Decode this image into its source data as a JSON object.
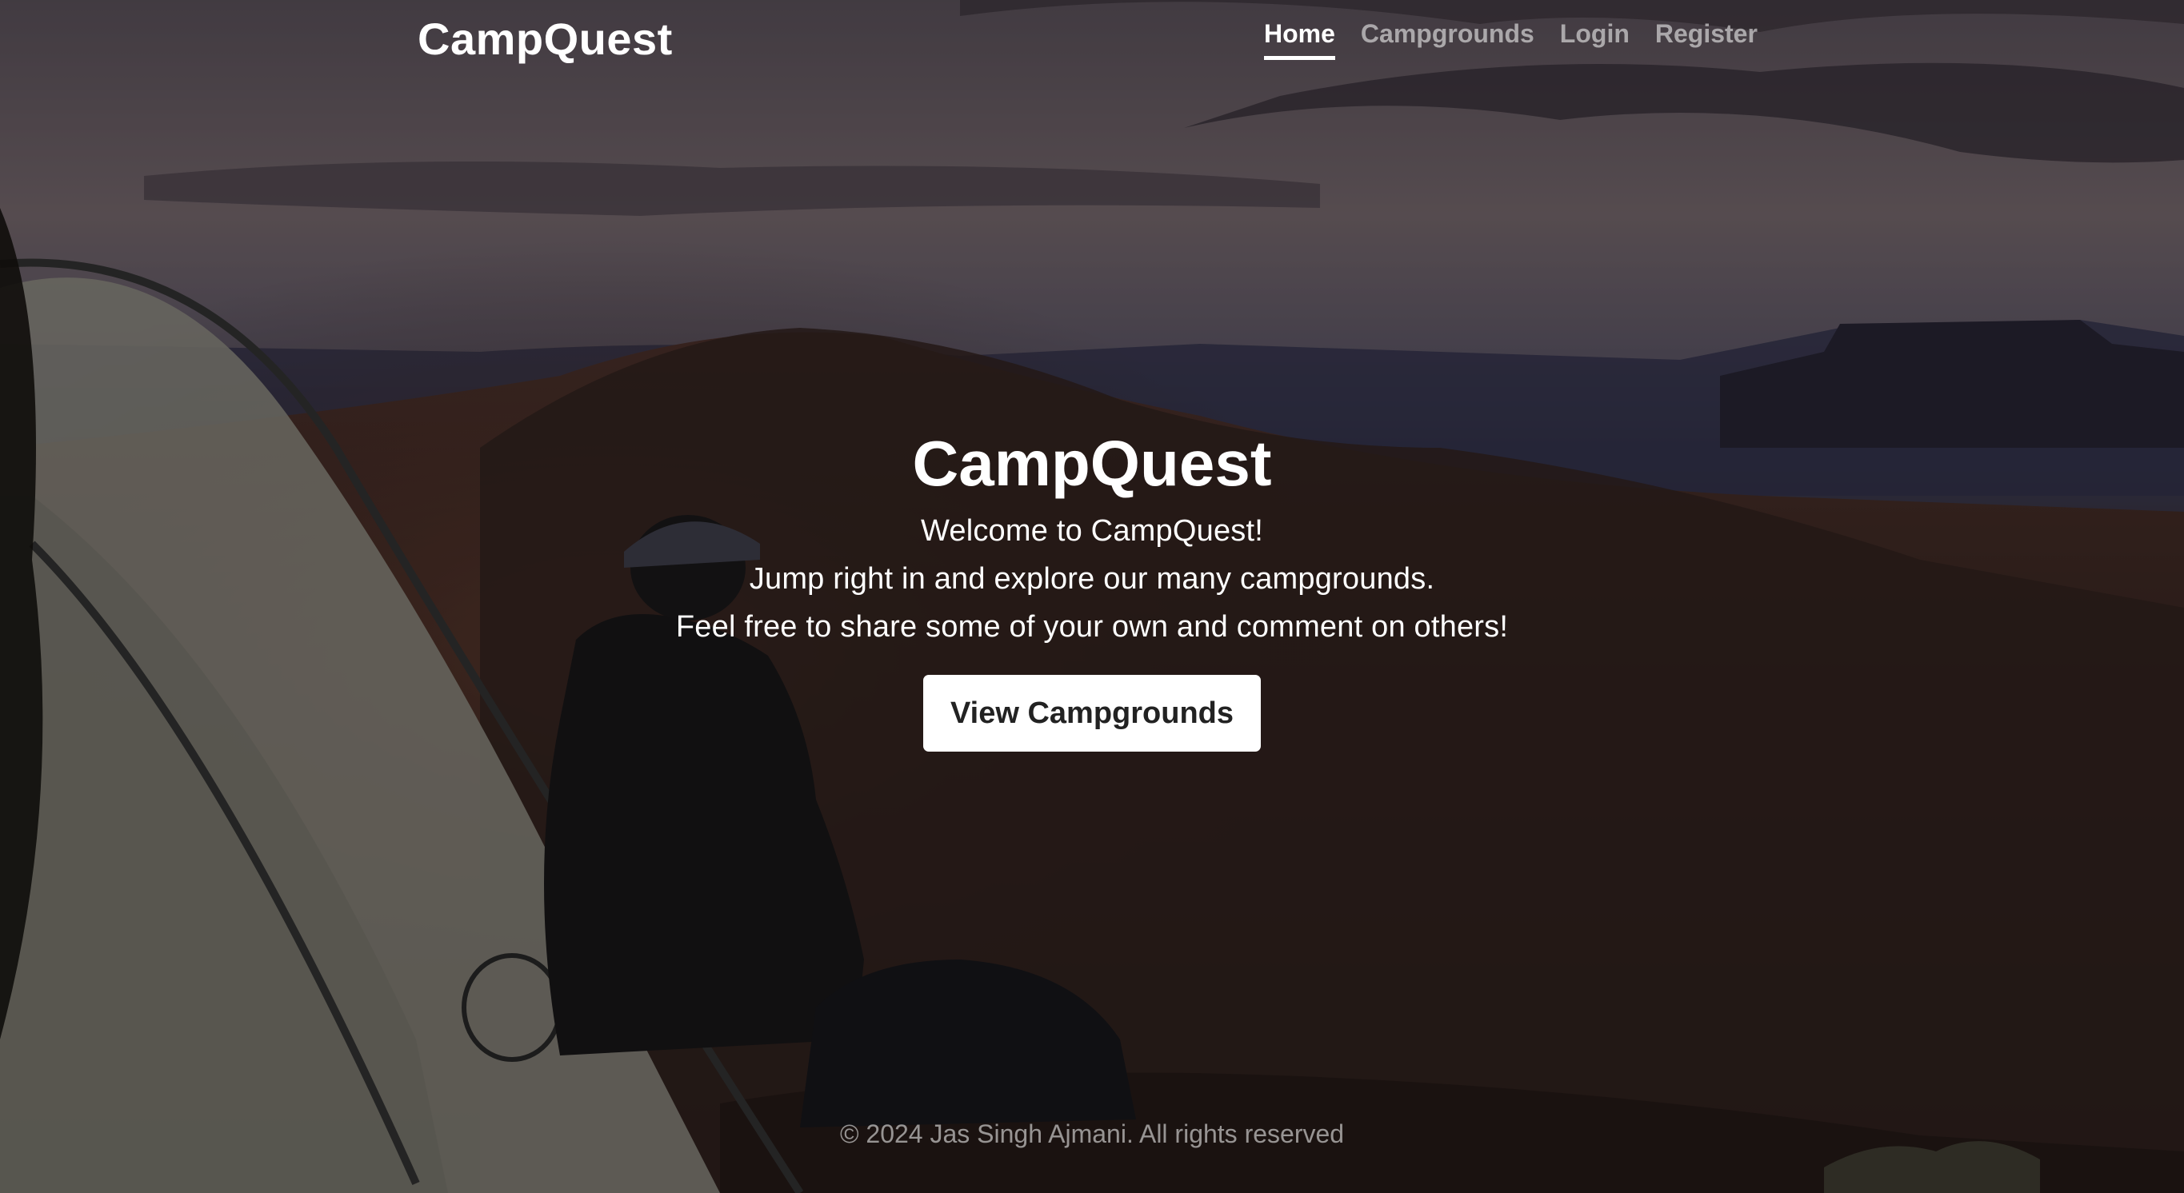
{
  "brand": {
    "name": "CampQuest"
  },
  "nav": {
    "items": [
      {
        "label": "Home",
        "active": true
      },
      {
        "label": "Campgrounds",
        "active": false
      },
      {
        "label": "Login",
        "active": false
      },
      {
        "label": "Register",
        "active": false
      }
    ]
  },
  "hero": {
    "title": "CampQuest",
    "lines": [
      "Welcome to CampQuest!",
      "Jump right in and explore our many campgrounds.",
      "Feel free to share some of your own and comment on others!"
    ],
    "cta_label": "View Campgrounds"
  },
  "footer": {
    "text": "© 2024 Jas Singh Ajmani. All rights reserved"
  },
  "colors": {
    "text_primary": "#ffffff",
    "text_muted": "#b3b3b3",
    "button_bg": "#ffffff",
    "button_text": "#222222"
  }
}
